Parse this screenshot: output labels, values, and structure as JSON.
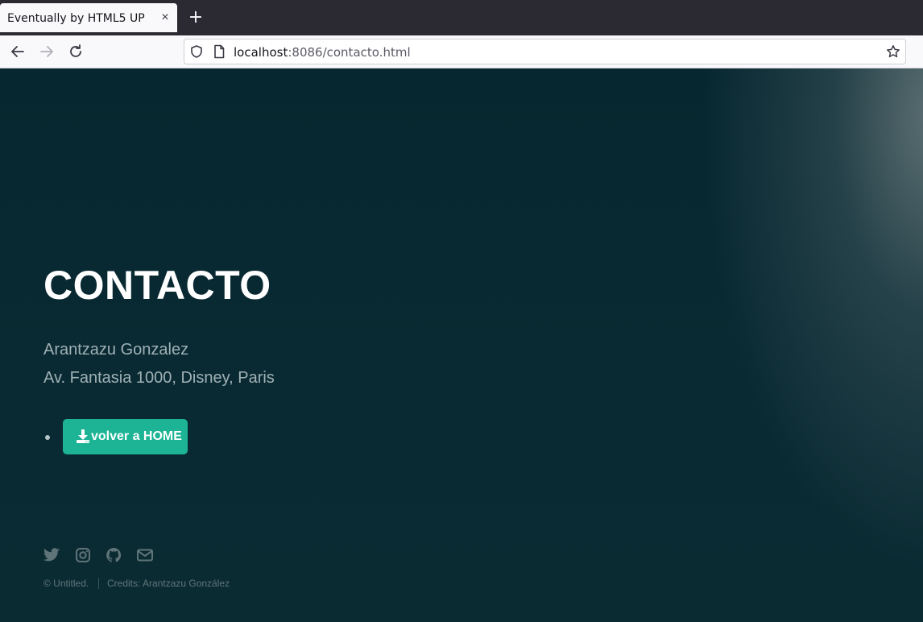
{
  "browser": {
    "tab_title": "Eventually by HTML5 UP",
    "tab_close": "×",
    "new_tab": "+",
    "url_host": "localhost",
    "url_rest": ":8086/contacto.html"
  },
  "page": {
    "title": "CONTACTO",
    "name": "Arantzazu Gonzalez",
    "address": "Av. Fantasia 1000, Disney, Paris",
    "button_label": "volver a HOME"
  },
  "footer": {
    "social_icons": [
      "twitter-icon",
      "instagram-icon",
      "github-icon",
      "envelope-icon"
    ],
    "copyright": "© Untitled.",
    "credits": "Credits: Arantzazu González"
  },
  "colors": {
    "accent": "#1cb495",
    "background": "#0b2a33"
  }
}
